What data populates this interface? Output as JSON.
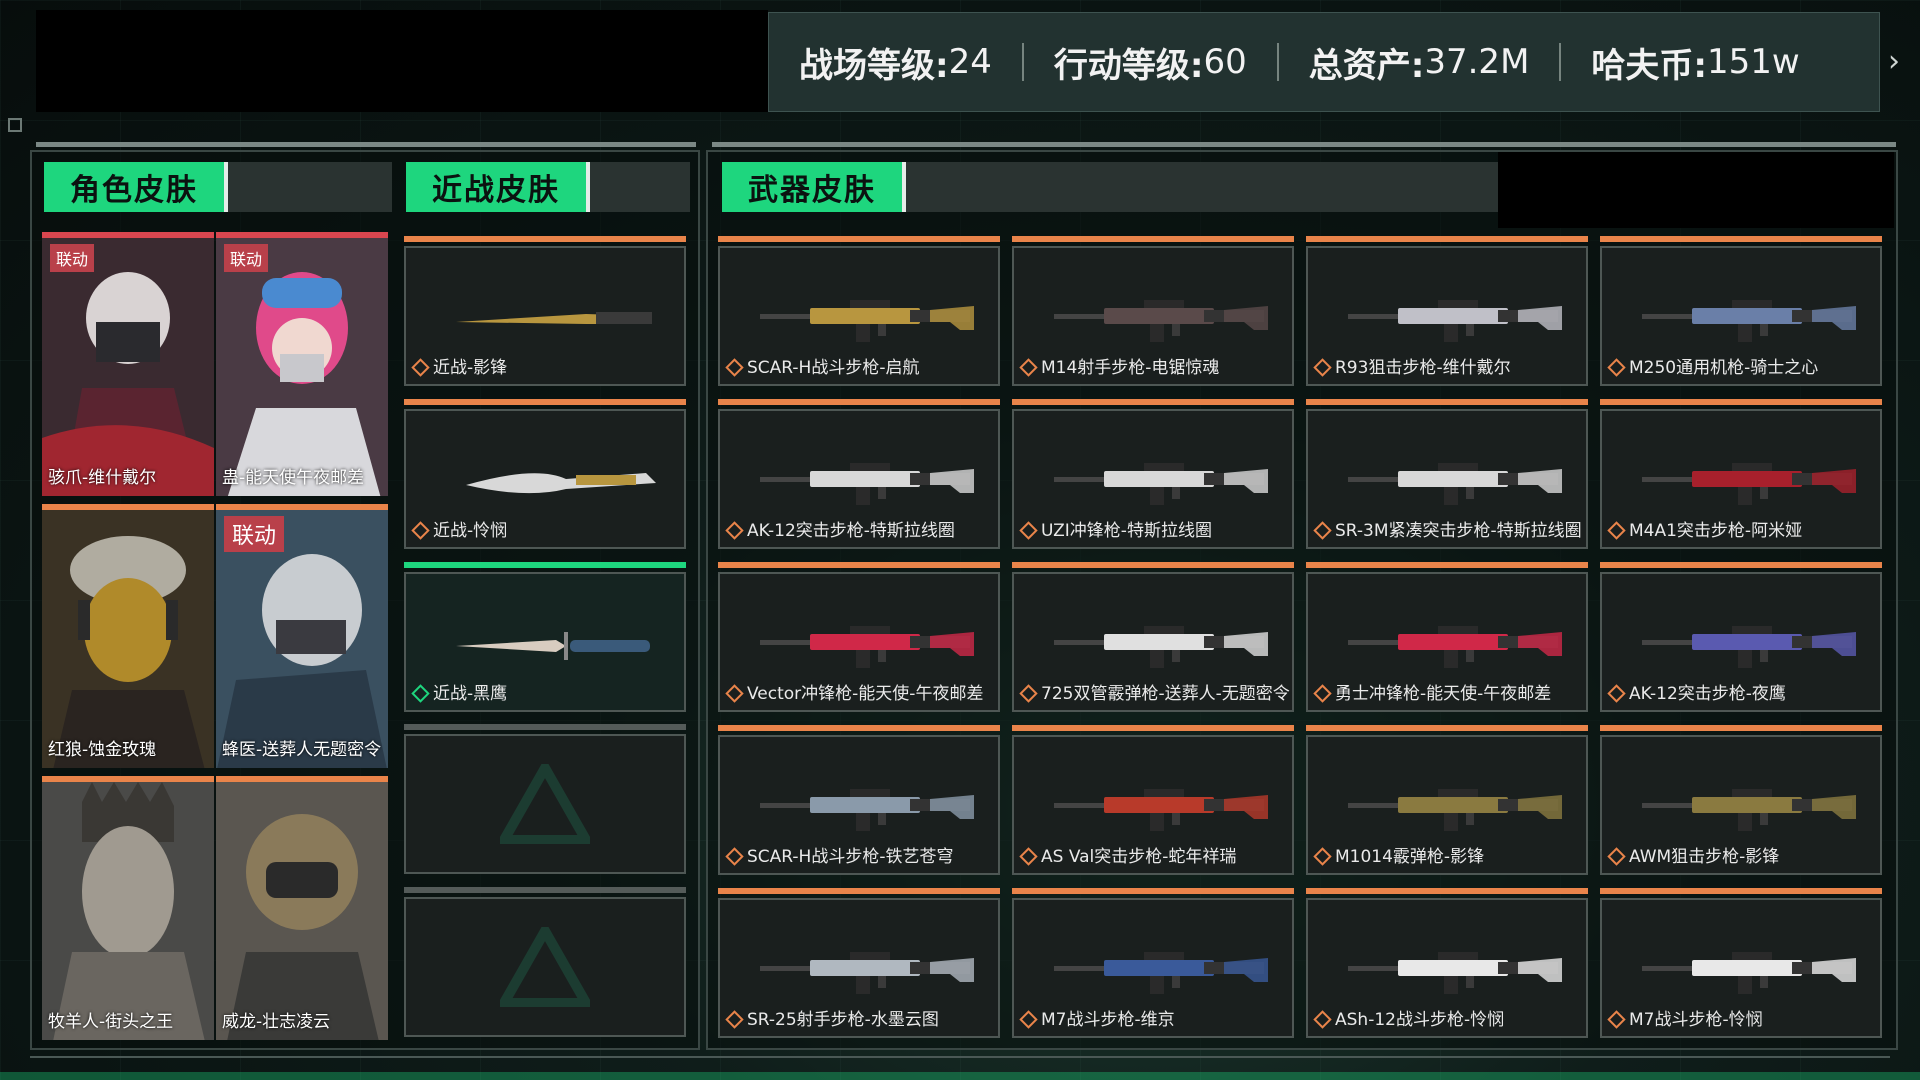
{
  "header": {
    "stats": [
      {
        "label": "战场等级:",
        "value": "24"
      },
      {
        "label": "行动等级:",
        "value": "60"
      },
      {
        "label": "总资产:",
        "value": "37.2M"
      },
      {
        "label": "哈夫币:",
        "value": "151w"
      }
    ],
    "next_icon": "chevron-right-icon"
  },
  "tabs": {
    "character": "角色皮肤",
    "melee": "近战皮肤",
    "weapon": "武器皮肤"
  },
  "characters": [
    {
      "name": "骇爪-维什戴尔",
      "badge": "联动"
    },
    {
      "name": "蛊-能天使午夜邮差",
      "badge": "联动"
    },
    {
      "name": "红狼-蚀金玫瑰",
      "badge": ""
    },
    {
      "name": "蜂医-送葬人无题密令",
      "badge": "联动"
    },
    {
      "name": "牧羊人-街头之王",
      "badge": ""
    },
    {
      "name": "威龙-壮志凌云",
      "badge": ""
    }
  ],
  "melee": [
    {
      "name": "近战-影锋"
    },
    {
      "name": "近战-怜悯"
    },
    {
      "name": "近战-黑鹰"
    }
  ],
  "weapons": [
    {
      "name": "SCAR-H战斗步枪-启航",
      "color": "#b8963f"
    },
    {
      "name": "M14射手步枪-电锯惊魂",
      "color": "#5a4a4a"
    },
    {
      "name": "R93狙击步枪-维什戴尔",
      "color": "#c0c0c8"
    },
    {
      "name": "M250通用机枪-骑士之心",
      "color": "#6a7fa8"
    },
    {
      "name": "AK-12突击步枪-特斯拉线圈",
      "color": "#d8d8d8"
    },
    {
      "name": "UZI冲锋枪-特斯拉线圈",
      "color": "#d8d8d8"
    },
    {
      "name": "SR-3M紧凑突击步枪-特斯拉线圈",
      "color": "#d8d8d8"
    },
    {
      "name": "M4A1突击步枪-阿米娅",
      "color": "#a8202c"
    },
    {
      "name": "Vector冲锋枪-能天使-午夜邮差",
      "color": "#d02848"
    },
    {
      "name": "725双管霰弹枪-送葬人-无题密令",
      "color": "#e0e0e0"
    },
    {
      "name": "勇士冲锋枪-能天使-午夜邮差",
      "color": "#d02848"
    },
    {
      "name": "AK-12突击步枪-夜鹰",
      "color": "#5a5ab0"
    },
    {
      "name": "SCAR-H战斗步枪-铁艺苍穹",
      "color": "#8a9aaa"
    },
    {
      "name": "AS Val突击步枪-蛇年祥瑞",
      "color": "#b83a2a"
    },
    {
      "name": "M1014霰弹枪-影锋",
      "color": "#8a7a40"
    },
    {
      "name": "AWM狙击步枪-影锋",
      "color": "#8a7a40"
    },
    {
      "name": "SR-25射手步枪-水墨云图",
      "color": "#b0b8c0"
    },
    {
      "name": "M7战斗步枪-维京",
      "color": "#3a5a9a"
    },
    {
      "name": "ASh-12战斗步枪-怜悯",
      "color": "#e8e8e8"
    },
    {
      "name": "M7战斗步枪-怜悯",
      "color": "#e8e8e8"
    }
  ]
}
